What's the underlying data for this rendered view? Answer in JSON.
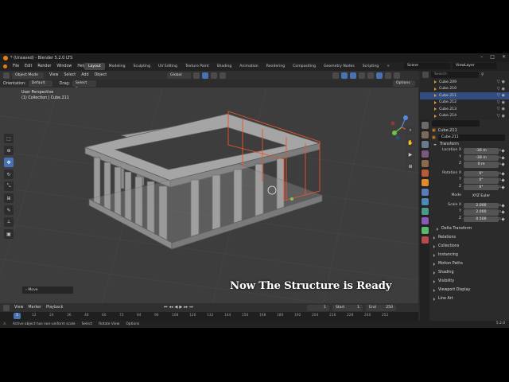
{
  "title_bar": {
    "text": "* (Unsaved) - Blender 5.2.0 LTS"
  },
  "menu": [
    "File",
    "Edit",
    "Render",
    "Window",
    "Help"
  ],
  "workspace_tabs": [
    "Layout",
    "Modeling",
    "Sculpting",
    "UV Editing",
    "Texture Paint",
    "Shading",
    "Animation",
    "Rendering",
    "Compositing",
    "Geometry Nodes",
    "Scripting"
  ],
  "active_tab": "Layout",
  "scene": "Scene",
  "view_layer": "ViewLayer",
  "viewport_header": {
    "mode": "Object Mode",
    "menus": [
      "View",
      "Select",
      "Add",
      "Object"
    ],
    "transform": "Global"
  },
  "tool_settings": {
    "orientation_label": "Orientation:",
    "orientation_value": "Default",
    "drag_label": "Drag:",
    "drag_value": "Select Box",
    "options": "Options"
  },
  "viewport_info": {
    "line1": "User Perspective",
    "line2": "(1) Collection | Cube.211"
  },
  "last_operator": "Move",
  "caption": "Now The Structure is Ready",
  "timeline": {
    "menus": [
      "View",
      "Marker",
      "Playback"
    ],
    "current_frame": "1",
    "start_label": "Start",
    "start": "1",
    "end_label": "End",
    "end": "250",
    "ticks": [
      "1",
      "12",
      "24",
      "36",
      "48",
      "60",
      "72",
      "84",
      "96",
      "108",
      "120",
      "132",
      "144",
      "156",
      "168",
      "180",
      "192",
      "204",
      "216",
      "228",
      "240",
      "252"
    ]
  },
  "status_bar": {
    "message": "Active object has non-uniform scale",
    "hints": [
      "Select",
      "Rotate View",
      "Options"
    ],
    "version": "5.2.0"
  },
  "outliner": {
    "search_placeholder": "Search",
    "items": [
      {
        "name": "Cube.209",
        "selected": false
      },
      {
        "name": "Cube.210",
        "selected": false
      },
      {
        "name": "Cube.211",
        "selected": true
      },
      {
        "name": "Cube.212",
        "selected": false
      },
      {
        "name": "Cube.213",
        "selected": false
      },
      {
        "name": "Cube.214",
        "selected": false
      }
    ]
  },
  "properties": {
    "object_name_header": "Cube.211",
    "object_name": "Cube.211",
    "transform_label": "Transform",
    "location_label": "Location X",
    "location": [
      "-36 m",
      "-38 m",
      "0 m"
    ],
    "rotation_label": "Rotation X",
    "rotation": [
      "0°",
      "0°",
      "0°"
    ],
    "mode_label": "Mode",
    "mode": "XYZ Euler",
    "scale_label": "Scale X",
    "scale": [
      "2.000",
      "2.000",
      "0.500"
    ],
    "axis_y": "Y",
    "axis_z": "Z",
    "sections": [
      "Delta Transform",
      "Relations",
      "Collections",
      "Instancing",
      "Motion Paths",
      "Shading",
      "Visibility",
      "Viewport Display",
      "Line Art"
    ]
  },
  "colors": {
    "accent": "#4772b3",
    "selection_orange": "#e8542a",
    "header": "#303030",
    "viewport": "#3d3d3d"
  }
}
